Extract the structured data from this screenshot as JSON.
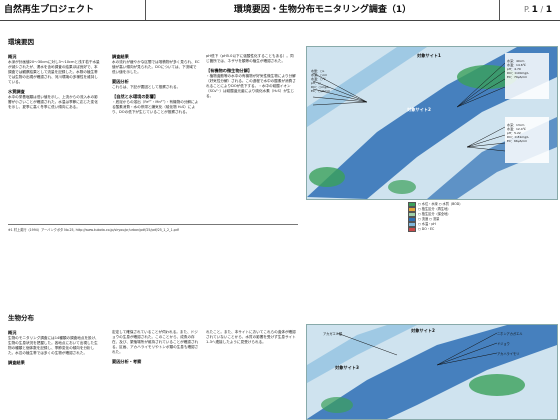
{
  "header": {
    "left": "自然再生プロジェクト",
    "center": "環境要因・生物分布モニタリング調査（1）",
    "page": "P.",
    "current": "1",
    "sep": "/",
    "total": "1"
  },
  "section1": {
    "title": "環境要因",
    "col1": [
      {
        "h": "概況",
        "t": "水深が計画値20〜30cmに対し3〜10cmと浅す若干水量が減少されたが、湧水を含め調査の結果ほぼ良好で、本調査では観察結果として流量を記録した。水際の植生帯では生物の出現が確認され、河川環境の多様性を維持している。"
      },
      {
        "h": "水質調査",
        "t": "水中の栄養塩類は低い値を示し、上流からの流入水の影響が小さいことが確認された。水温は季節に応じた変化を示し、夏季に高く冬季に低い傾向にある。"
      }
    ],
    "col2": [
      {
        "h": "調査結果",
        "t": "水の流れが緩やかな区間では堆積物が多く見られ、EC値が高い傾向が見られた。DOについては、下流域で低い値を示した。"
      },
      {
        "h": "要因分析",
        "t": "これらは、下記が要因として推察される。"
      },
      {
        "h": "【自然と水環境の影響】",
        "t": "・底泥からの溶出（Fe²⁺・Mn²⁺）・有機物の分解による酸素消費・水の停滞と嫌気化（硫化物 H₂S）により、DOの低下が生じていることが推察される。"
      }
    ],
    "col3": [
      {
        "h": "",
        "t": "pH低下（pH5.0以下に強酸性化することもある）。同じ箇所では、ネザサを類等の植生が確認された。"
      },
      {
        "h": "【有機物の微生物分解】",
        "t": "・植物遺骸等の水中の有機物が好気性微生物により分解（好気性分解）される。この過程で水中の酸素が消費されることによりDOが低下する。・水中の硫酸イオン（SO₄²⁻）は硫酸還元菌により硫化水素（H₂S）が生じる。"
      }
    ],
    "footnote": "※1 村上英行（1994）アーバンクボタ No.25, http://www.kubota.co.jp/siryou/pr/urban/pdf/25/pdf/25_1_2_1.pdf",
    "map": {
      "site1": "対象サイト1",
      "site2": "対象サイト2",
      "labelsA": [
        "水量：○L",
        "水深：○cm",
        "水温：○℃",
        "pH：○",
        "DO：○mg/L",
        "EC：○μS/cm"
      ],
      "labelsB": [
        "水深：40cm",
        "水温：14.6℃",
        "pH：4.70",
        "DO：0.00mg/L",
        "EC：79μS/cm"
      ],
      "labelsC": [
        "水深：13cm",
        "水温：12.4℃",
        "pH：5.22",
        "DO：0.81mg/L",
        "EC：66μS/cm"
      ],
      "legend": [
        "○ 水位・水深 ○ 水質（BOD）",
        "○ 植生区分（再生地）",
        "○ 植生区分（保全地）",
        "○ 流速 ○ 流量",
        "○ 水温・pH",
        "○ DO・EC"
      ]
    }
  },
  "section2": {
    "title": "生物分布",
    "col1": [
      {
        "h": "概況",
        "t": "生物のモニタリング調査には14種類の調査地点を設け、生物の生息状況を把握した。各地点において出現した生物の種類と個体数を記録し、季節変化の傾向を分析した。水辺の植生帯では多くの生物が確認された。"
      },
      {
        "h": "調査結果",
        "t": ""
      }
    ],
    "col2": [
      {
        "h": "",
        "t": "定定して確保されていることが伺われる。また、ドジョウの生息が確認された。このことから、成魚の存在、及び、繁殖場所が維持されていることが確認される。区画、アカハライモリやトンボ類の生息も確認された。"
      },
      {
        "h": "要因分析・考察",
        "t": ""
      }
    ],
    "col3": [
      {
        "h": "",
        "t": "れたこと。また、本サイトにおいてこれらの遺体が確認されていないことから、水質の影響を受けず生息サイト1-3へ連接したように見受けられる。"
      }
    ],
    "map": {
      "site2": "対象サイト2",
      "site3": "対象サイト3",
      "species": [
        "ニホンアカガエル",
        "ドジョウ",
        "アカハライモリ"
      ],
      "leftLabel": "アカガエル類"
    }
  }
}
